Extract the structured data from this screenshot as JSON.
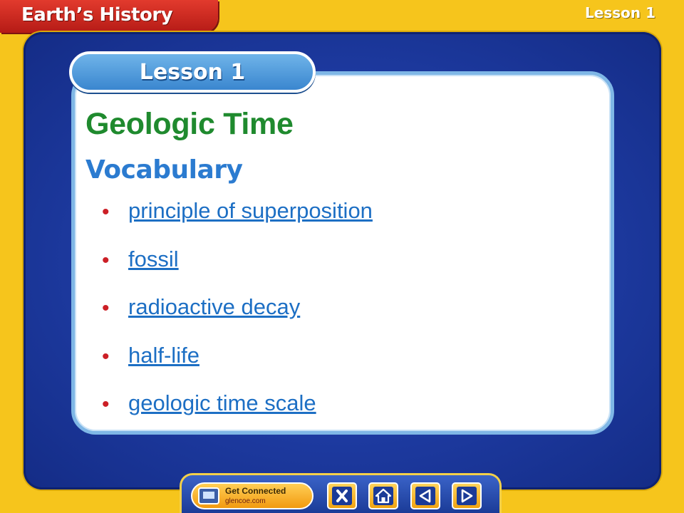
{
  "header": {
    "book_title": "Earth’s History",
    "corner_label": "Lesson 1"
  },
  "card": {
    "lesson_tab": "Lesson 1",
    "title": "Geologic Time",
    "section_heading": "Vocabulary",
    "vocabulary": [
      "principle of superposition",
      "fossil",
      "radioactive decay",
      "half-life",
      "geologic time scale"
    ]
  },
  "toolbar": {
    "get_connected_label": "Get Connected",
    "get_connected_sub": "glencoe.com",
    "buttons": [
      "close-icon",
      "home-icon",
      "previous-arrow-icon",
      "next-arrow-icon"
    ]
  },
  "colors": {
    "background": "#f6c51c",
    "frame_blue": "#1d3aa0",
    "title_green": "#1f8a2e",
    "heading_blue": "#2b7bd0",
    "link_blue": "#1d6fc4",
    "bullet_red": "#cc1f26",
    "book_tab_red": "#c5221b"
  }
}
